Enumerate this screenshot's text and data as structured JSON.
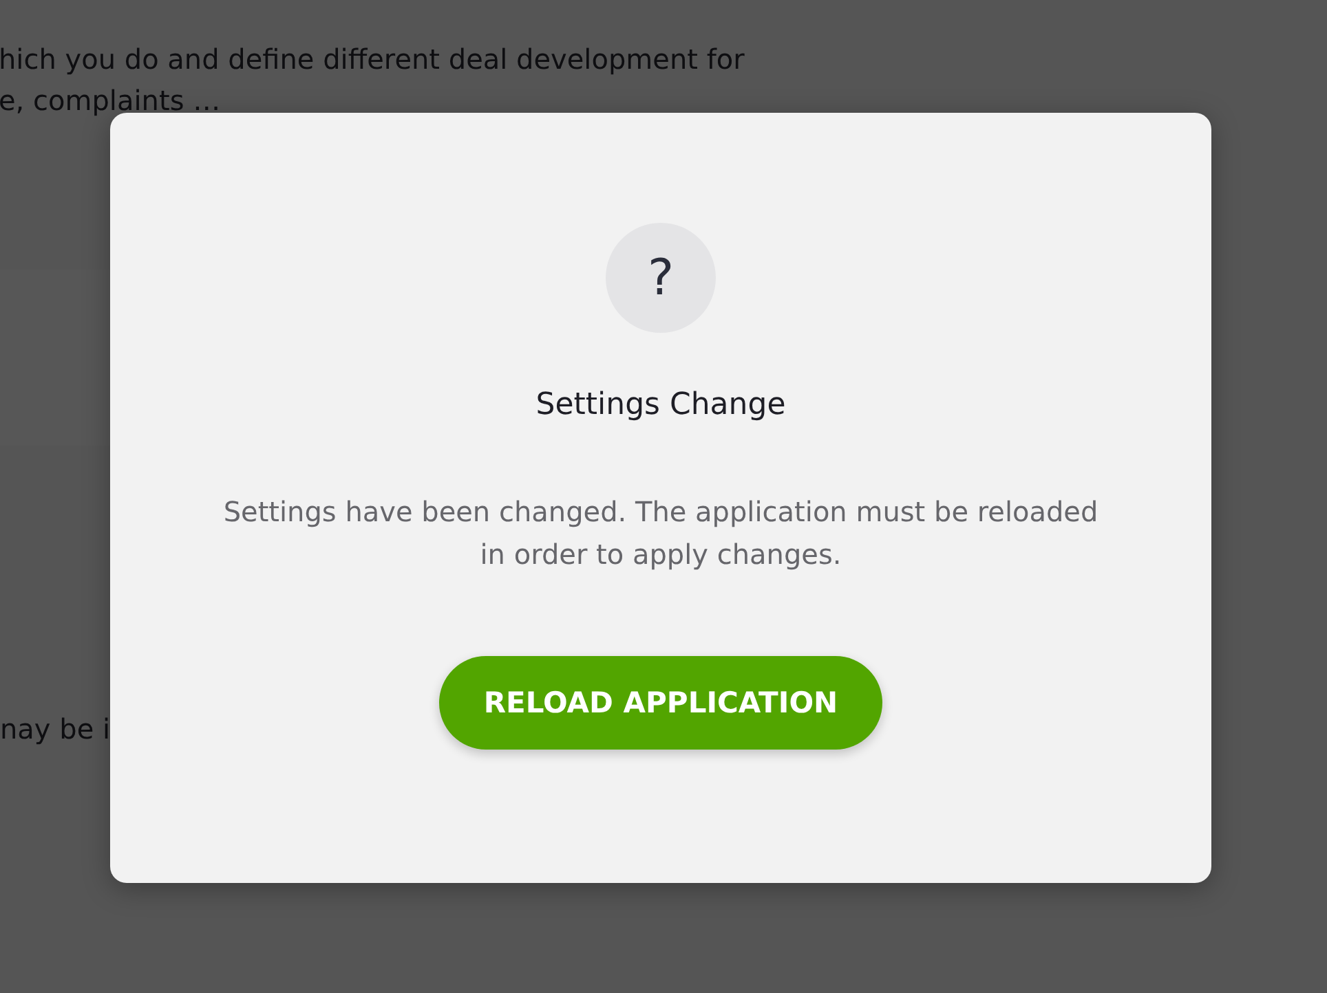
{
  "background": {
    "paragraph_lines": [
      "hich you do and define different deal development for",
      "e, complaints …"
    ],
    "fragment": "nay be i"
  },
  "dialog": {
    "icon": "?",
    "title": "Settings Change",
    "message": "Settings have been changed. The application must be reloaded in order to apply changes.",
    "button": "RELOAD APPLICATION"
  }
}
